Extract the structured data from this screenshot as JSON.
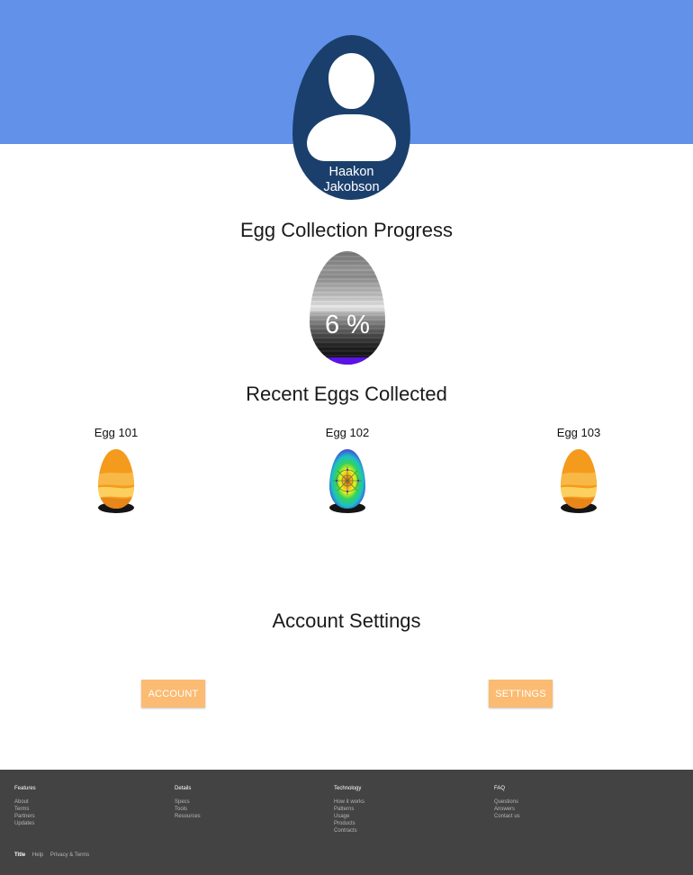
{
  "profile": {
    "first_name": "Haakon",
    "last_name": "Jakobson",
    "avatar_icon": "user-silhouette-icon",
    "header_color": "#6291e9",
    "egg_color": "#1b3f6c"
  },
  "progress": {
    "title": "Egg Collection Progress",
    "percent": 6,
    "label": "6 %",
    "fill_color": "#5a12e6"
  },
  "recent": {
    "title": "Recent Eggs Collected",
    "eggs": [
      {
        "label": "Egg 101",
        "pattern": "orange-wave-egg-icon"
      },
      {
        "label": "Egg 102",
        "pattern": "rainbow-mandala-egg-icon"
      },
      {
        "label": "Egg 103",
        "pattern": "orange-wave-egg-icon"
      }
    ]
  },
  "account": {
    "title": "Account Settings",
    "account_button": "ACCOUNT",
    "settings_button": "SETTINGS",
    "button_color": "#fbbb72"
  },
  "footer": {
    "columns": [
      {
        "heading": "Features",
        "links": [
          "About",
          "Terms",
          "Partners",
          "Updates"
        ]
      },
      {
        "heading": "Details",
        "links": [
          "Specs",
          "Tools",
          "Resources"
        ]
      },
      {
        "heading": "Technology",
        "links": [
          "How it works",
          "Patterns",
          "Usage",
          "Products",
          "Contracts"
        ]
      },
      {
        "heading": "FAQ",
        "links": [
          "Questions",
          "Answers",
          "Contact us"
        ]
      }
    ],
    "bottom": {
      "title": "Title",
      "help": "Help",
      "privacy": "Privacy & Terms"
    },
    "background": "#434343"
  }
}
